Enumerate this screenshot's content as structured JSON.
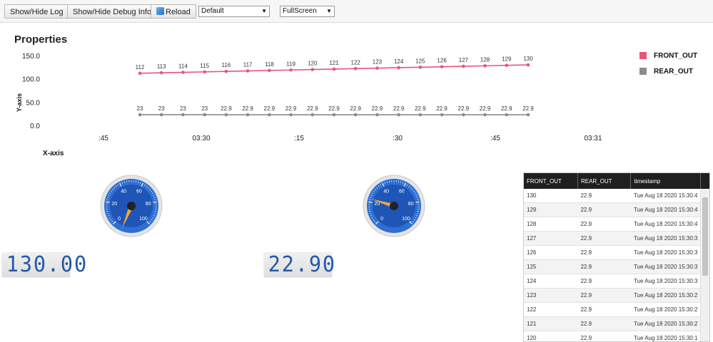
{
  "toolbar": {
    "log_label": "Show/Hide Log",
    "debug_label": "Show/Hide Debug Info",
    "reload_label": "Reload",
    "theme_value": "Default",
    "view_value": "FullScreen"
  },
  "page_title": "Properties",
  "chart_data": {
    "type": "line",
    "xlabel": "X-axis",
    "ylabel": "Y-axis",
    "ylim": [
      0,
      150
    ],
    "y_ticks": [
      "150.0",
      "100.0",
      "50.0",
      "0.0"
    ],
    "x_ticks": [
      ":45",
      "03:30",
      ":15",
      ":30",
      ":45",
      "03:31"
    ],
    "series": [
      {
        "name": "FRONT_OUT",
        "color": "#e8557a",
        "labels": [
          "112",
          "113",
          "114",
          "115",
          "116",
          "117",
          "118",
          "119",
          "120",
          "121",
          "122",
          "123",
          "124",
          "125",
          "126",
          "127",
          "128",
          "129",
          "130"
        ]
      },
      {
        "name": "REAR_OUT",
        "color": "#8c8c8c",
        "labels": [
          "23",
          "23",
          "23",
          "23",
          "22.9",
          "22.9",
          "22.9",
          "22.9",
          "22.9",
          "22.9",
          "22.9",
          "22.9",
          "22.9",
          "22.9",
          "22.9",
          "22.9",
          "22.9",
          "22.9",
          "22.9"
        ]
      }
    ],
    "values": {
      "FRONT_OUT": [
        112,
        113,
        114,
        115,
        116,
        117,
        118,
        119,
        120,
        121,
        122,
        123,
        124,
        125,
        126,
        127,
        128,
        129,
        130
      ],
      "REAR_OUT": [
        23,
        23,
        23,
        23,
        22.9,
        22.9,
        22.9,
        22.9,
        22.9,
        22.9,
        22.9,
        22.9,
        22.9,
        22.9,
        22.9,
        22.9,
        22.9,
        22.9,
        22.9
      ]
    },
    "legend_placement": "top-right"
  },
  "gauges": [
    {
      "value": 130,
      "ticks": [
        "0",
        "20",
        "40",
        "60",
        "80",
        "100"
      ],
      "display": "130.00"
    },
    {
      "value": 22.9,
      "ticks": [
        "0",
        "20",
        "40",
        "60",
        "80",
        "100"
      ],
      "display": "22.90"
    }
  ],
  "table": {
    "columns": [
      "FRONT_OUT",
      "REAR_OUT",
      "timestamp"
    ],
    "rows": [
      [
        "130",
        "22.9",
        "Tue Aug 18 2020 15:30:4"
      ],
      [
        "129",
        "22.9",
        "Tue Aug 18 2020 15:30:4"
      ],
      [
        "128",
        "22.9",
        "Tue Aug 18 2020 15:30:4"
      ],
      [
        "127",
        "22.9",
        "Tue Aug 18 2020 15:30:3"
      ],
      [
        "126",
        "22.9",
        "Tue Aug 18 2020 15:30:3"
      ],
      [
        "125",
        "22.9",
        "Tue Aug 18 2020 15:30:3"
      ],
      [
        "124",
        "22.9",
        "Tue Aug 18 2020 15:30:3"
      ],
      [
        "123",
        "22.9",
        "Tue Aug 18 2020 15:30:2"
      ],
      [
        "122",
        "22.9",
        "Tue Aug 18 2020 15:30:2"
      ],
      [
        "121",
        "22.9",
        "Tue Aug 18 2020 15:30:2"
      ],
      [
        "120",
        "22.9",
        "Tue Aug 18 2020 15:30:1"
      ]
    ]
  }
}
